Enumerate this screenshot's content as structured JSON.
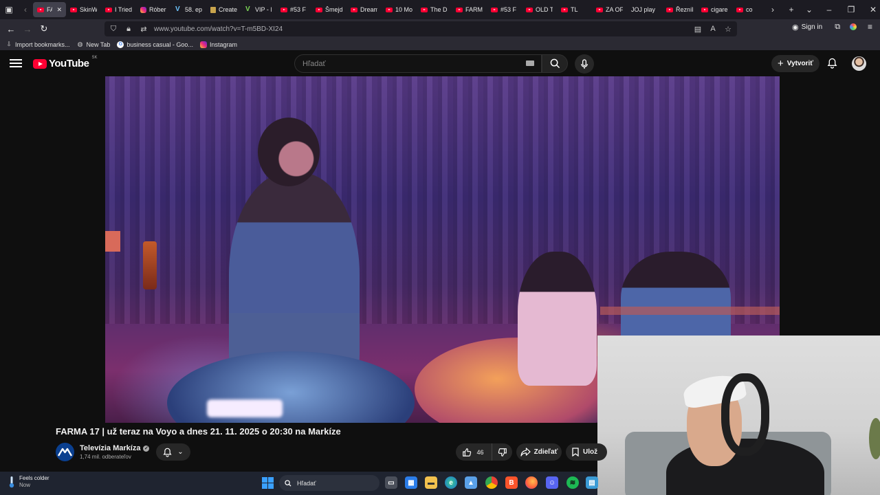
{
  "browser": {
    "tabs": [
      {
        "label": "FAR",
        "icon": "youtube-icon",
        "active": true
      },
      {
        "label": "SkinW",
        "icon": "youtube-icon"
      },
      {
        "label": "I Tried",
        "icon": "youtube-icon"
      },
      {
        "label": "Róber",
        "icon": "instagram-icon"
      },
      {
        "label": "58. ep",
        "icon": "v-icon"
      },
      {
        "label": "Create",
        "icon": "doc-icon"
      },
      {
        "label": "VIP - l",
        "icon": "vip-icon"
      },
      {
        "label": "#53 F",
        "icon": "youtube-icon"
      },
      {
        "label": "Šmejd",
        "icon": "youtube-icon"
      },
      {
        "label": "Dream",
        "icon": "youtube-icon"
      },
      {
        "label": "10 Mo",
        "icon": "youtube-icon"
      },
      {
        "label": "The D",
        "icon": "youtube-icon"
      },
      {
        "label": "FARM",
        "icon": "youtube-icon"
      },
      {
        "label": "#53 F",
        "icon": "youtube-icon"
      },
      {
        "label": "OLD T",
        "icon": "youtube-icon"
      },
      {
        "label": "TL",
        "icon": "youtube-icon"
      },
      {
        "label": "ZA OF",
        "icon": "youtube-icon"
      },
      {
        "label": "JOJ play",
        "icon": "none"
      },
      {
        "label": "Řezník",
        "icon": "youtube-icon"
      },
      {
        "label": "cigare",
        "icon": "youtube-icon"
      },
      {
        "label": "co",
        "icon": "youtube-icon"
      }
    ],
    "url": "www.youtube.com/watch?v=T-m5BD-XI24",
    "sign_in_label": "Sign in",
    "bookmarks": [
      {
        "label": "Import bookmarks...",
        "icon": "import-icon"
      },
      {
        "label": "New Tab",
        "icon": "globe-icon"
      },
      {
        "label": "business casual - Goo...",
        "icon": "google-icon"
      },
      {
        "label": "Instagram",
        "icon": "instagram-icon"
      }
    ]
  },
  "youtube": {
    "logo_text": "YouTube",
    "region": "SK",
    "search_placeholder": "Hľadať",
    "create_label": "Vytvoriť",
    "video": {
      "title": "FARMA 17 | už teraz na Voyo a dnes 21. 11. 2025 o 20:30 na Markíze",
      "channel_name": "Televízia Markíza",
      "subscribers": "1,74 mil. odberateľov",
      "likes": "46",
      "share_label": "Zdieľať",
      "save_label": "Ulož"
    }
  },
  "taskbar": {
    "weather_title": "Feels colder",
    "weather_sub": "Now",
    "search_placeholder": "Hľadať"
  }
}
